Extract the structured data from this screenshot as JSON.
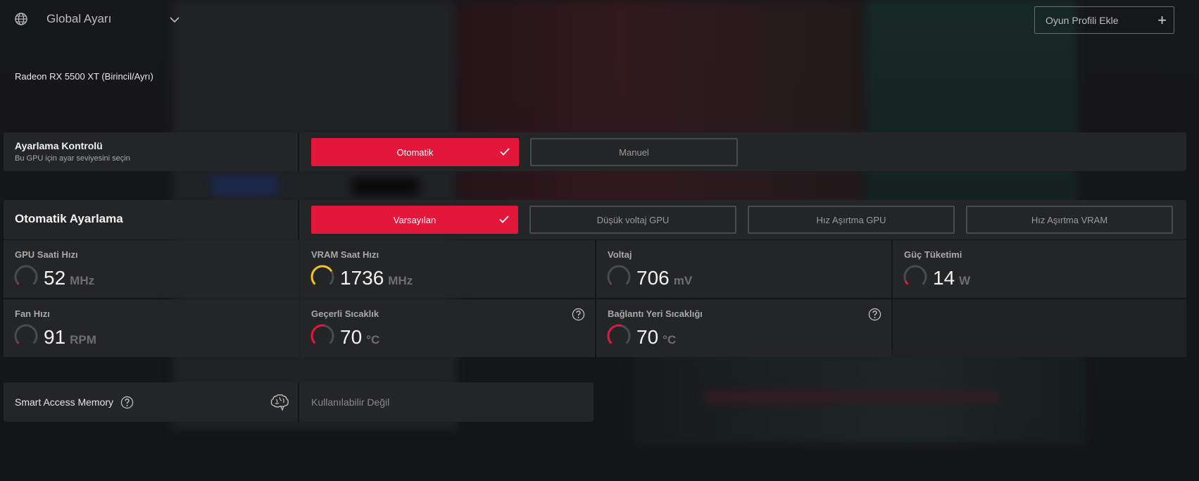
{
  "header": {
    "profile_selector": "Global Ayarı",
    "add_profile_button": "Oyun Profili Ekle",
    "gpu_name": "Radeon RX 5500 XT (Birincil/Ayrı)"
  },
  "tuning_control": {
    "title": "Ayarlama Kontrolü",
    "subtitle": "Bu GPU için ayar seviyesini seçin",
    "options": [
      "Otomatik",
      "Manuel"
    ],
    "selected": "Otomatik"
  },
  "auto_tuning": {
    "title": "Otomatik Ayarlama",
    "options": [
      "Varsayılan",
      "Düşük voltaj GPU",
      "Hız Aşırtma GPU",
      "Hız Aşırtma VRAM"
    ],
    "selected": "Varsayılan"
  },
  "metrics": [
    {
      "name": "GPU Saati Hızı",
      "value": "52",
      "unit": "MHz",
      "level": 0.03,
      "color": "#e2173b"
    },
    {
      "name": "VRAM Saat Hızı",
      "value": "1736",
      "unit": "MHz",
      "level": 0.72,
      "color": "#f2c21b"
    },
    {
      "name": "Voltaj",
      "value": "706",
      "unit": "mV",
      "level": 0.0,
      "color": "#e2173b"
    },
    {
      "name": "Güç Tüketimi",
      "value": "14",
      "unit": "W",
      "level": 0.08,
      "color": "#e2173b"
    },
    {
      "name": "Fan Hızı",
      "value": "91",
      "unit": "RPM",
      "level": 0.03,
      "color": "#e2173b"
    },
    {
      "name": "Geçerli Sıcaklık",
      "value": "70",
      "unit": "°C",
      "level": 0.55,
      "color": "#e2173b"
    },
    {
      "name": "Bağlantı Yeri Sıcaklığı",
      "value": "70",
      "unit": "°C",
      "level": 0.55,
      "color": "#e2173b"
    }
  ],
  "smart_access_memory": {
    "label": "Smart Access Memory",
    "value": "Kullanılabilir Değil"
  },
  "colors": {
    "accent": "#e2173b",
    "panel": "#242526",
    "background": "#151618"
  }
}
